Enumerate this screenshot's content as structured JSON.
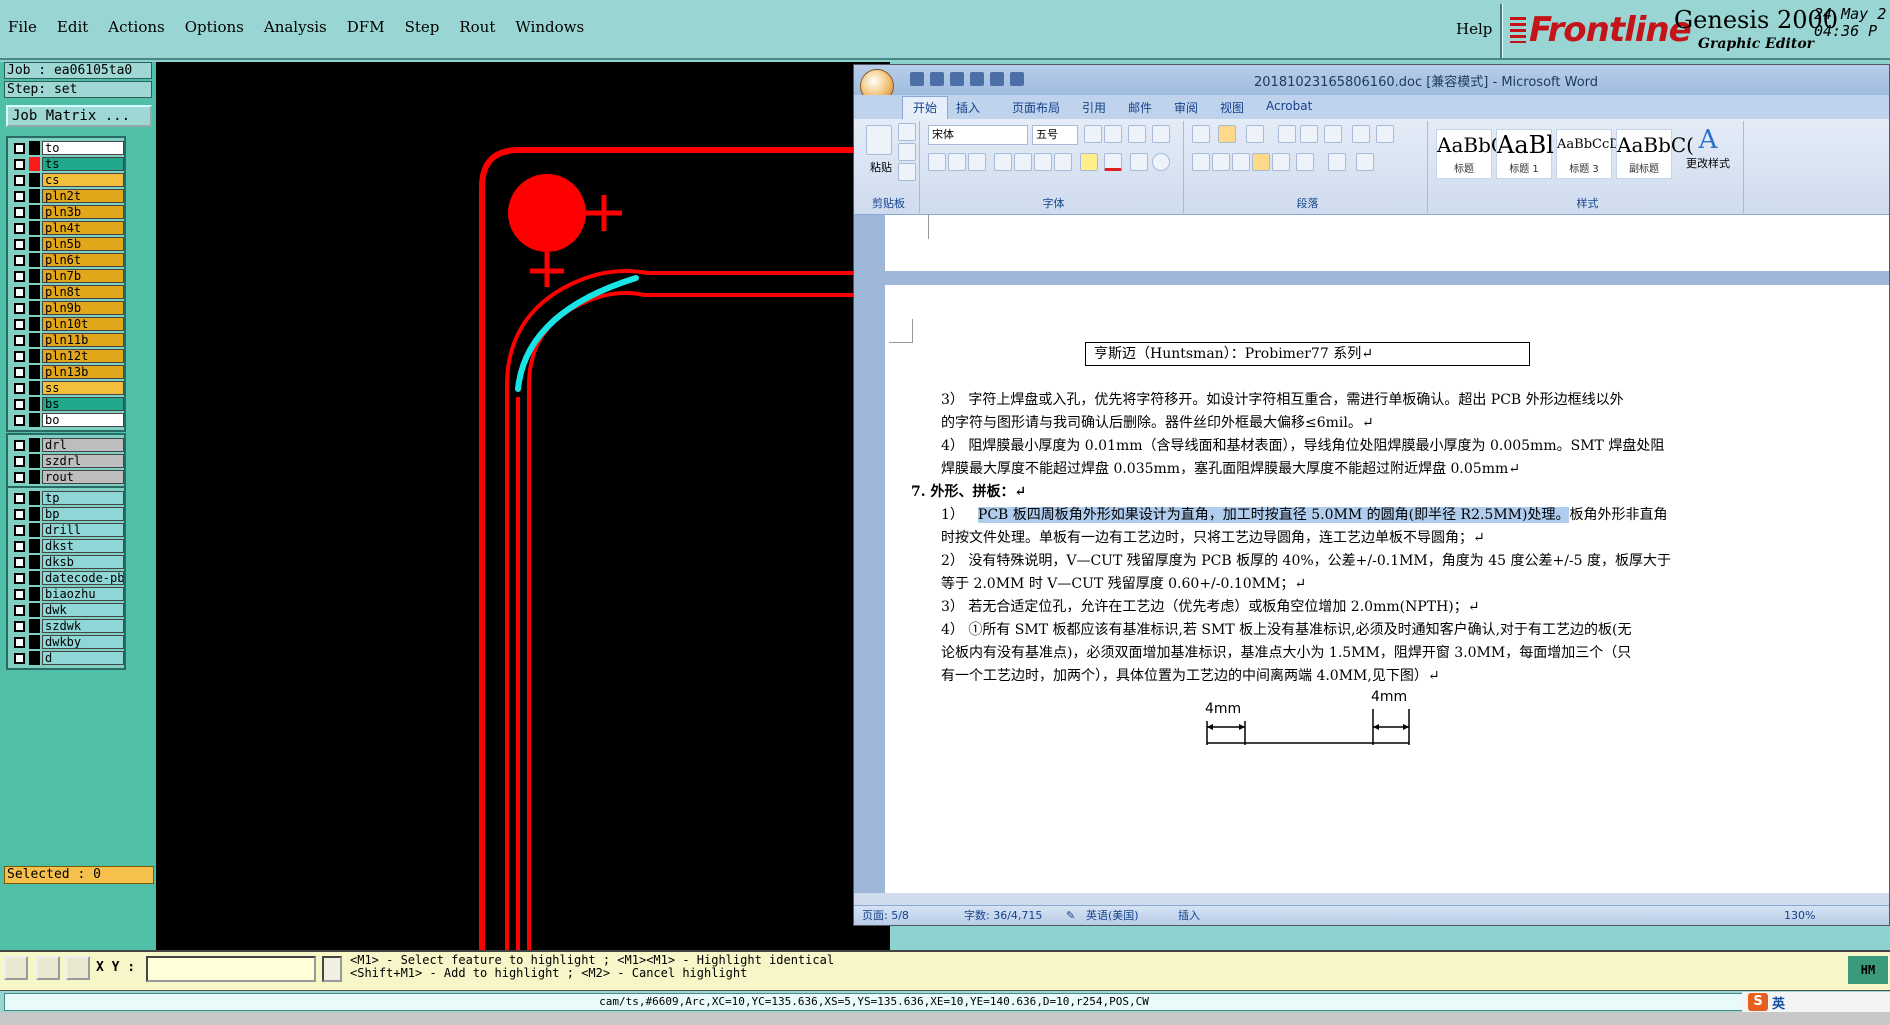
{
  "menu": [
    "File",
    "Edit",
    "Actions",
    "Options",
    "Analysis",
    "DFM",
    "Step",
    "Rout",
    "Windows"
  ],
  "help": "Help",
  "brand": {
    "logo": "Frontline",
    "title": "Genesis 2000",
    "subtitle": "Graphic Editor",
    "date": "24 May 2",
    "time": "04:36 P"
  },
  "job": {
    "job": "Job : ea06105ta0",
    "step": "Step: set",
    "matrix": "Job Matrix ..."
  },
  "layers": {
    "group1": [
      {
        "name": "to",
        "color": "#ffffff",
        "sw": "#000000"
      },
      {
        "name": "ts",
        "color": "#1fa88a",
        "sw": "#ff1a1a",
        "active": true
      },
      {
        "name": "cs",
        "color": "#f2be3c",
        "sw": "#000000"
      },
      {
        "name": "pln2t",
        "color": "#e1a619",
        "sw": "#000000"
      },
      {
        "name": "pln3b",
        "color": "#e1a619",
        "sw": "#000000"
      },
      {
        "name": "pln4t",
        "color": "#e1a619",
        "sw": "#000000"
      },
      {
        "name": "pln5b",
        "color": "#e1a619",
        "sw": "#000000"
      },
      {
        "name": "pln6t",
        "color": "#e1a619",
        "sw": "#000000"
      },
      {
        "name": "pln7b",
        "color": "#e1a619",
        "sw": "#000000"
      },
      {
        "name": "pln8t",
        "color": "#e1a619",
        "sw": "#000000"
      },
      {
        "name": "pln9b",
        "color": "#e1a619",
        "sw": "#000000"
      },
      {
        "name": "pln10t",
        "color": "#e1a619",
        "sw": "#000000"
      },
      {
        "name": "pln11b",
        "color": "#e1a619",
        "sw": "#000000"
      },
      {
        "name": "pln12t",
        "color": "#e1a619",
        "sw": "#000000"
      },
      {
        "name": "pln13b",
        "color": "#e1a619",
        "sw": "#000000"
      },
      {
        "name": "ss",
        "color": "#f2be3c",
        "sw": "#000000"
      },
      {
        "name": "bs",
        "color": "#1fa88a",
        "sw": "#000000"
      },
      {
        "name": "bo",
        "color": "#ffffff",
        "sw": "#000000"
      }
    ],
    "group2": [
      {
        "name": "drl",
        "color": "#bdbdbd",
        "sw": "#000000"
      },
      {
        "name": "szdrl",
        "color": "#bdbdbd",
        "sw": "#000000"
      },
      {
        "name": "rout",
        "color": "#bdbdbd",
        "sw": "#000000"
      }
    ],
    "group3": [
      {
        "name": "tp",
        "color": "#8fd6d6",
        "sw": "#000000"
      },
      {
        "name": "bp",
        "color": "#8fd6d6",
        "sw": "#000000"
      },
      {
        "name": "drill",
        "color": "#8fd6d6",
        "sw": "#000000"
      },
      {
        "name": "dkst",
        "color": "#8fd6d6",
        "sw": "#000000"
      },
      {
        "name": "dksb",
        "color": "#8fd6d6",
        "sw": "#000000"
      },
      {
        "name": "datecode-pbo",
        "color": "#8fd6d6",
        "sw": "#000000"
      },
      {
        "name": "biaozhu",
        "color": "#8fd6d6",
        "sw": "#000000"
      },
      {
        "name": "dwk",
        "color": "#8fd6d6",
        "sw": "#000000"
      },
      {
        "name": "szdwk",
        "color": "#8fd6d6",
        "sw": "#000000"
      },
      {
        "name": "dwkby",
        "color": "#8fd6d6",
        "sw": "#000000"
      },
      {
        "name": "d",
        "color": "#8fd6d6",
        "sw": "#000000"
      }
    ]
  },
  "selected": "Selected : 0",
  "xy_label": "X Y :",
  "hint_line1": "<M1> - Select feature to highlight ; <M1><M1> - Highlight identical",
  "hint_line2": "<Shift+M1> - Add to highlight ; <M2> - Cancel highlight",
  "hm": "HM",
  "status_line": "cam/ts,#6609,Arc,XC=10,YC=135.636,XS=5,YS=135.636,XE=10,YE=140.636,D=10,r254,POS,CW",
  "tray": {
    "logo": "S",
    "lang": "英"
  },
  "word": {
    "title": "20181023165806160.doc [兼容模式] - Microsoft Word",
    "tabs": [
      "开始",
      "插入",
      "页面布局",
      "引用",
      "邮件",
      "审阅",
      "视图",
      "Acrobat"
    ],
    "font_name": "宋体",
    "font_size": "五号",
    "groups": {
      "clipboard": "剪贴板",
      "font": "字体",
      "paragraph": "段落",
      "styles": "样式"
    },
    "paste": "粘贴",
    "change_styles": "更改样式",
    "styles": [
      {
        "sample": "AaBbC(",
        "label": "标题"
      },
      {
        "sample": "AaBl",
        "label": "标题 1"
      },
      {
        "sample": "AaBbCcD(",
        "label": "标题 3"
      },
      {
        "sample": "AaBbC(",
        "label": "副标题"
      }
    ],
    "boxed": "亨斯迈（Huntsman）：Probimer77 系列↵",
    "lines": [
      "3）  字符上焊盘或入孔，优先将字符移开。如设计字符相互重合，需进行单板确认。超出 PCB 外形边框线以外",
      "      的字符与图形请与我司确认后删除。器件丝印外框最大偏移≤6mil。↵",
      "4）  阻焊膜最小厚度为 0.01mm（含导线面和基材表面），导线角位处阻焊膜最小厚度为 0.005mm。SMT 焊盘处阻",
      "      焊膜最大厚度不能超过焊盘 0.035mm，塞孔面阻焊膜最大厚度不能超过附近焊盘 0.05mm↵",
      "7.   外形、拼板：↵",
      "PCB 板四周板角外形如果设计为直角，加工时按直径 5.0MM 的圆角(即半径 R2.5MM)处理。",
      "板角外形非直角",
      "      时按文件处理。单板有一边有工艺边时，只将工艺边导圆角，连工艺边单板不导圆角；↵",
      "2）  没有特殊说明，V—CUT 残留厚度为 PCB 板厚的 40%，公差+/-0.1MM，角度为 45 度公差+/-5 度，板厚大于",
      "      等于 2.0MM 时 V—CUT 残留厚度 0.60+/-0.10MM；↵",
      "3）  若无合适定位孔，允许在工艺边（优先考虑）或板角空位增加 2.0mm(NPTH)；↵",
      "4）  ①所有 SMT 板都应该有基准标识,若 SMT 板上没有基准标识,必须及时通知客户确认,对于有工艺边的板(无",
      "      论板内有没有基准点)，必须双面增加基准标识，基准点大小为 1.5MM，阻焊开窗 3.0MM，每面增加三个（只",
      "      有一个工艺边时，加两个），具体位置为工艺边的中间离两端 4.0MM,见下图）↵"
    ],
    "item_1": "1）",
    "dim_label": "4mm",
    "status": {
      "page": "页面: 5/8",
      "words": "字数: 36/4,715",
      "lang": "英语(美国)",
      "mode": "插入",
      "zoom": "130%"
    }
  }
}
